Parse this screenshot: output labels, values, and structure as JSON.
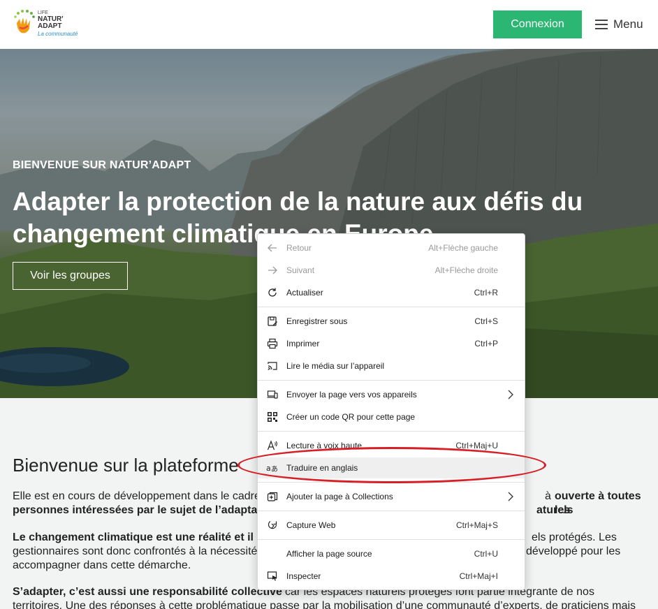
{
  "header": {
    "logo": {
      "line1": "LIFE",
      "line2": "NATUR'",
      "line3": "ADAPT",
      "tagline": "La communauté"
    },
    "login_label": "Connexion",
    "menu_label": "Menu"
  },
  "hero": {
    "kicker": "BIENVENUE SUR NATUR’ADAPT",
    "title": "Adapter la protection de la nature aux défis du changement climatique en Europe",
    "groups_button": "Voir les groupes"
  },
  "content": {
    "heading": "Bienvenue sur la plateforme",
    "p1_a": "Elle est en cours de développement dans le cadre",
    "p1_b": "à",
    "p1_c": "ouverte à toutes les",
    "p1_d": "personnes intéressées par le sujet de l’adapta",
    "p1_e": "aturels",
    "p1_f": ".",
    "p2_a": "Le changement climatique est une réalité et il",
    "p2_b": "els protégés. Les",
    "p2_c": "gestionnaires sont donc confrontés à la nécessité",
    "p2_d": "développé pour les",
    "p2_e": "accompagner dans cette démarche.",
    "p3_a": "S’adapter, c’est aussi une responsabilité collective",
    "p3_b": "car les espaces naturels protégés font partie intégrante de nos",
    "p3_c": "territoires. Une des réponses à cette problématique passe par la mobilisation d’une communauté d’experts, de praticiens mais"
  },
  "context_menu": {
    "items": [
      {
        "label": "Retour",
        "shortcut": "Alt+Flèche gauche",
        "icon": "arrow-left-icon",
        "enabled": false
      },
      {
        "label": "Suivant",
        "shortcut": "Alt+Flèche droite",
        "icon": "arrow-right-icon",
        "enabled": false
      },
      {
        "label": "Actualiser",
        "shortcut": "Ctrl+R",
        "icon": "refresh-icon",
        "enabled": true
      },
      {
        "label": "Enregistrer sous",
        "shortcut": "Ctrl+S",
        "icon": "save-as-icon",
        "enabled": true
      },
      {
        "label": "Imprimer",
        "shortcut": "Ctrl+P",
        "icon": "printer-icon",
        "enabled": true
      },
      {
        "label": "Lire le média sur l’appareil",
        "shortcut": "",
        "icon": "cast-icon",
        "enabled": true
      },
      {
        "label": "Envoyer la page vers vos appareils",
        "shortcut": "",
        "icon": "devices-icon",
        "enabled": true,
        "submenu": true
      },
      {
        "label": "Créer un code QR pour cette page",
        "shortcut": "",
        "icon": "qr-code-icon",
        "enabled": true
      },
      {
        "label": "Lecture à voix haute",
        "shortcut": "Ctrl+Maj+U",
        "icon": "read-aloud-icon",
        "enabled": true
      },
      {
        "label": "Traduire en anglais",
        "shortcut": "",
        "icon": "translate-icon",
        "enabled": true,
        "highlighted": true
      },
      {
        "label": "Ajouter la page à Collections",
        "shortcut": "",
        "icon": "collections-icon",
        "enabled": true,
        "submenu": true
      },
      {
        "label": "Capture Web",
        "shortcut": "Ctrl+Maj+S",
        "icon": "web-capture-icon",
        "enabled": true
      },
      {
        "label": "Afficher la page source",
        "shortcut": "Ctrl+U",
        "icon": "",
        "enabled": true
      },
      {
        "label": "Inspecter",
        "shortcut": "Ctrl+Maj+I",
        "icon": "inspect-icon",
        "enabled": true
      }
    ]
  },
  "colors": {
    "brand_green": "#2cb673",
    "annotation_red": "#d62027",
    "menu_highlight": "#efefef"
  }
}
